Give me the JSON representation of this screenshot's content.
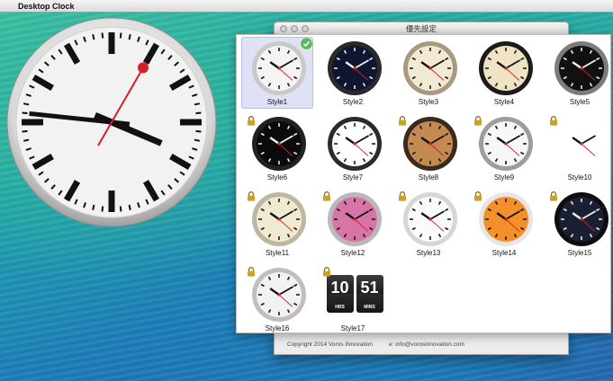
{
  "menubar": {
    "apple_glyph": "",
    "app_name": "Desktop Clock"
  },
  "preferences_window": {
    "title": "優先設定",
    "footer": {
      "copyright": "Copyright 2014 Voros iNnovation",
      "email": "e: info@vorosinnovation.com"
    }
  },
  "desktop_clock": {
    "hour": 3,
    "minute": 46,
    "second": 5,
    "style": "Style1"
  },
  "styles": [
    {
      "label": "Style1",
      "selected": true,
      "locked": false,
      "face": "#f4f4f4",
      "rim": "#c9c9c9",
      "dark": false
    },
    {
      "label": "Style2",
      "selected": false,
      "locked": false,
      "face": "#0e1630",
      "rim": "#2a2a2a",
      "dark": true
    },
    {
      "label": "Style3",
      "selected": false,
      "locked": false,
      "face": "#f3ead6",
      "rim": "#a89a80",
      "dark": false
    },
    {
      "label": "Style4",
      "selected": false,
      "locked": false,
      "face": "#efe3c4",
      "rim": "#1b1b1b",
      "dark": false
    },
    {
      "label": "Style5",
      "selected": false,
      "locked": false,
      "face": "#111111",
      "rim": "#7c7c7c",
      "dark": true
    },
    {
      "label": "Style6",
      "selected": false,
      "locked": true,
      "face": "#0b0b0b",
      "rim": "#222222",
      "dark": true
    },
    {
      "label": "Style7",
      "selected": false,
      "locked": false,
      "face": "#ffffff",
      "rim": "#2b2b2b",
      "dark": false
    },
    {
      "label": "Style8",
      "selected": false,
      "locked": true,
      "face": "#c38a52",
      "rim": "#3a2a1c",
      "dark": false
    },
    {
      "label": "Style9",
      "selected": false,
      "locked": true,
      "face": "#f7f7f7",
      "rim": "#9d9d9d",
      "dark": false
    },
    {
      "label": "Style10",
      "selected": false,
      "locked": true,
      "face": "#ffffff",
      "rim": "#ffffff",
      "dark": false
    },
    {
      "label": "Style11",
      "selected": false,
      "locked": true,
      "face": "#f1ead2",
      "rim": "#bdb6a3",
      "dark": false
    },
    {
      "label": "Style12",
      "selected": false,
      "locked": true,
      "face": "#d874a8",
      "rim": "#b9b9b9",
      "dark": false
    },
    {
      "label": "Style13",
      "selected": false,
      "locked": true,
      "face": "#fbfbfb",
      "rim": "#d6d6d6",
      "dark": false
    },
    {
      "label": "Style14",
      "selected": false,
      "locked": true,
      "face": "#f3902a",
      "rim": "#e6e6e6",
      "dark": false
    },
    {
      "label": "Style15",
      "selected": false,
      "locked": true,
      "face": "#1a1f33",
      "rim": "#0e0e0e",
      "dark": true
    },
    {
      "label": "Style16",
      "selected": false,
      "locked": true,
      "face": "#f2f2f2",
      "rim": "#bfbfbf",
      "dark": false
    },
    {
      "label": "Style17",
      "selected": false,
      "locked": true,
      "flip": true,
      "flip_hours": "10",
      "flip_minutes": "51",
      "flip_hours_label": "HRS",
      "flip_minutes_label": "MINS"
    }
  ],
  "colors": {
    "accent_red": "#d61f26",
    "selected_bg": "#dfe2f4",
    "check_green": "#5cb85c",
    "lock_gold": "#c9a227"
  }
}
